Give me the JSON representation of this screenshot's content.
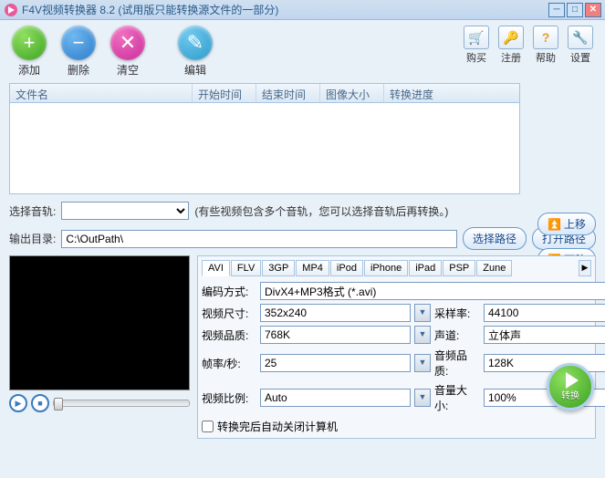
{
  "title": "F4V视频转换器 8.2 (试用版只能转换源文件的一部分)",
  "toolbar": {
    "add": "添加",
    "del": "删除",
    "clear": "清空",
    "edit": "编辑"
  },
  "rightbar": {
    "buy": "购买",
    "reg": "注册",
    "help": "帮助",
    "settings": "设置"
  },
  "columns": {
    "filename": "文件名",
    "start": "开始时间",
    "end": "结束时间",
    "size": "图像大小",
    "progress": "转换进度"
  },
  "side": {
    "up": "上移",
    "down": "下移"
  },
  "audio": {
    "label": "选择音轨:",
    "hint": "(有些视频包含多个音轨，您可以选择音轨后再转换。)"
  },
  "output": {
    "label": "输出目录:",
    "value": "C:\\OutPath\\",
    "browse": "选择路径",
    "open": "打开路径"
  },
  "tabs": [
    "AVI",
    "FLV",
    "3GP",
    "MP4",
    "iPod",
    "iPhone",
    "iPad",
    "PSP",
    "Zune"
  ],
  "settings": {
    "encode_label": "编码方式:",
    "encode_value": "DivX4+MP3格式 (*.avi)",
    "size_label": "视频尺寸:",
    "size_value": "352x240",
    "sample_label": "采样率:",
    "sample_value": "44100",
    "vq_label": "视频品质:",
    "vq_value": "768K",
    "channel_label": "声道:",
    "channel_value": "立体声",
    "fps_label": "帧率/秒:",
    "fps_value": "25",
    "aq_label": "音频品质:",
    "aq_value": "128K",
    "ratio_label": "视频比例:",
    "ratio_value": "Auto",
    "vol_label": "音量大小:",
    "vol_value": "100%",
    "shutdown": "转换完后自动关闭计算机"
  },
  "convert": "转换"
}
